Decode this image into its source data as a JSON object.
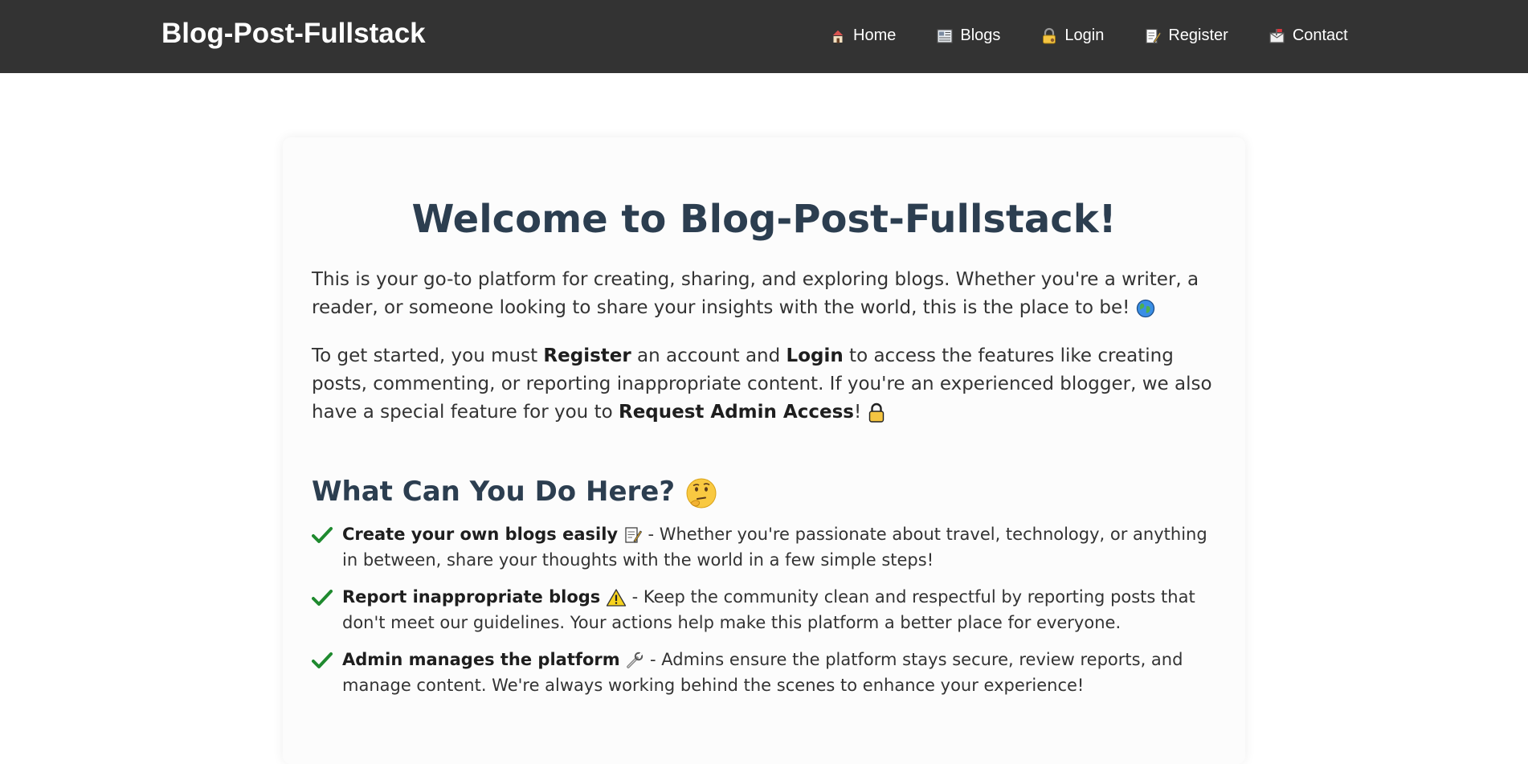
{
  "navbar": {
    "brand": "Blog-Post-Fullstack",
    "links": [
      {
        "label": "Home",
        "icon": "house-icon"
      },
      {
        "label": "Blogs",
        "icon": "newspaper-icon"
      },
      {
        "label": "Login",
        "icon": "lock-key-icon"
      },
      {
        "label": "Register",
        "icon": "memo-icon"
      },
      {
        "label": "Contact",
        "icon": "mailbox-icon"
      }
    ]
  },
  "main": {
    "title": "Welcome to Blog-Post-Fullstack!",
    "intro": "This is your go-to platform for creating, sharing, and exploring blogs. Whether you're a writer, a reader, or someone looking to share your insights with the world, this is the place to be!",
    "getting_started": {
      "part1": "To get started, you must ",
      "register": "Register",
      "part2": " an account and ",
      "login": "Login",
      "part3": " to access the features like creating posts, commenting, or reporting inappropriate content. If you're an experienced blogger, we also have a special feature for you to ",
      "request_admin": "Request Admin Access",
      "part4": "!"
    },
    "section_title": "What Can You Do Here?",
    "features": [
      {
        "title": "Create your own blogs easily",
        "icon": "memo-icon",
        "text": " - Whether you're passionate about travel, technology, or anything in between, share your thoughts with the world in a few simple steps!"
      },
      {
        "title": "Report inappropriate blogs",
        "icon": "warning-icon",
        "text": " - Keep the community clean and respectful by reporting posts that don't meet our guidelines. Your actions help make this platform a better place for everyone."
      },
      {
        "title": "Admin manages the platform",
        "icon": "wrench-icon",
        "text": " - Admins ensure the platform stays secure, review reports, and manage content. We're always working behind the scenes to enhance your experience!"
      }
    ]
  }
}
